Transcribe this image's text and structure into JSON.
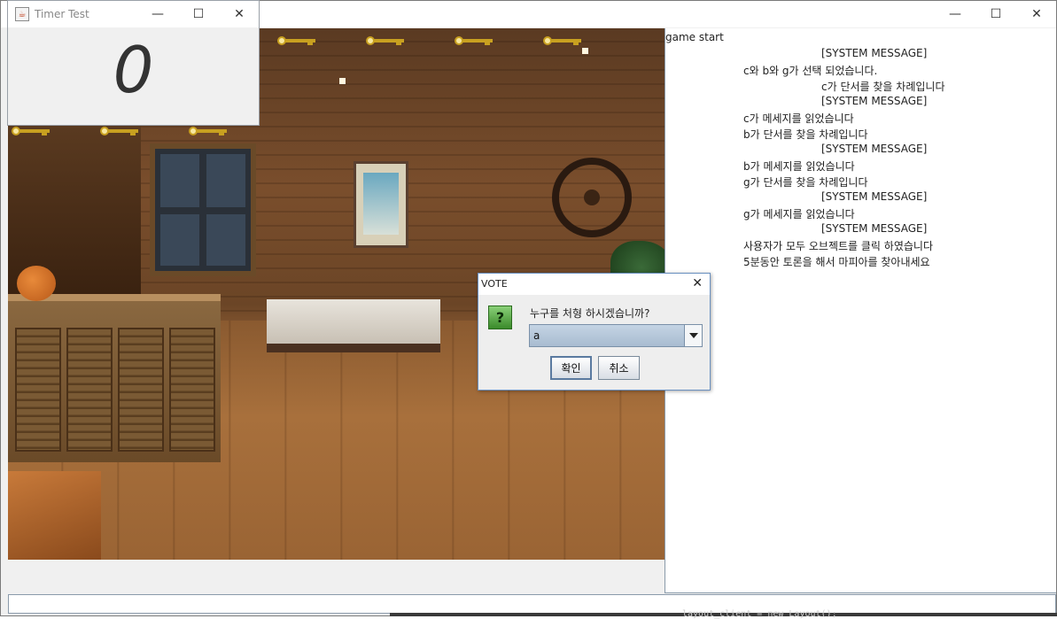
{
  "main_window": {
    "controls": [
      "—",
      "☐",
      "✕"
    ]
  },
  "chat": {
    "lines": [
      "game start",
      "[SYSTEM MESSAGE]",
      "c와 b와 g가 선택 되었습니다.",
      "c가 단서를 찾을 차례입니다",
      "[SYSTEM MESSAGE]",
      "c가 메세지를 읽었습니다",
      "b가 단서를 찾을 차례입니다",
      "[SYSTEM MESSAGE]",
      "b가 메세지를 읽었습니다",
      "g가 단서를 찾을 차례입니다",
      "[SYSTEM MESSAGE]",
      "g가 메세지를 읽었습니다",
      "[SYSTEM MESSAGE]",
      "사용자가 모두 오브젝트를 클릭 하였습니다",
      "5분동안 토론을 해서 마피아를 찾아내세요"
    ]
  },
  "timer_window": {
    "title": "Timer Test",
    "value": "0",
    "controls": [
      "—",
      "☐",
      "✕"
    ]
  },
  "vote_dialog": {
    "title": "VOTE",
    "close": "✕",
    "icon": "?",
    "question": "누구를 처형 하시겠습니까?",
    "selected": "a",
    "ok_label": "확인",
    "cancel_label": "취소"
  },
  "taskbar": {
    "code_snippet": "layout_client = new Layout();"
  }
}
